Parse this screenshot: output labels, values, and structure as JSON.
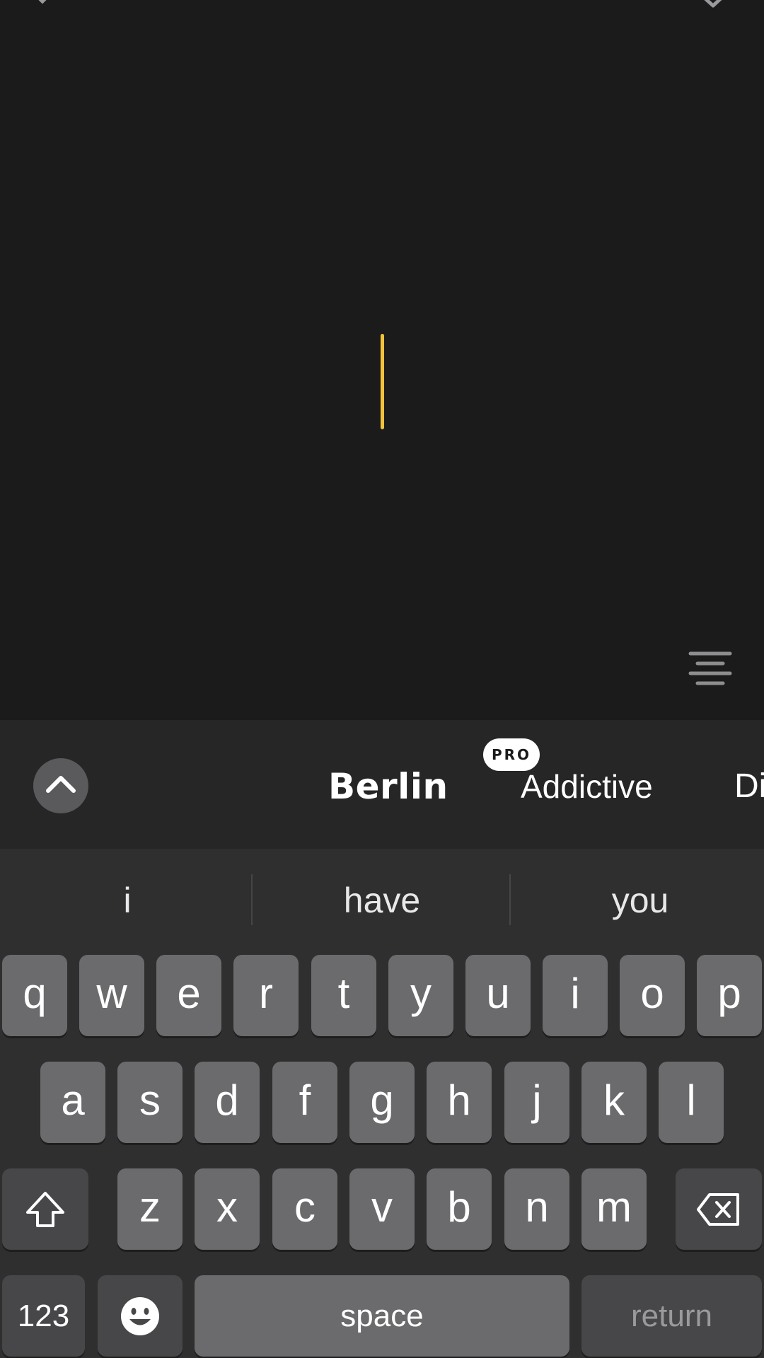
{
  "editor": {
    "close_icon": "close-icon",
    "done_icon": "checkmark-icon",
    "align_icon": "align-center-icon",
    "cursor_color": "#f3c23c"
  },
  "font_bar": {
    "toggle_icon": "chevron-up-icon",
    "fonts": [
      {
        "name": "Berlin",
        "selected": true
      },
      {
        "name": "Addictive",
        "badge": "PRO"
      },
      {
        "name": "Di"
      }
    ]
  },
  "keyboard": {
    "suggestions": [
      "i",
      "have",
      "you"
    ],
    "row1": [
      "q",
      "w",
      "e",
      "r",
      "t",
      "y",
      "u",
      "i",
      "o",
      "p"
    ],
    "row2": [
      "a",
      "s",
      "d",
      "f",
      "g",
      "h",
      "j",
      "k",
      "l"
    ],
    "row3": [
      "z",
      "x",
      "c",
      "v",
      "b",
      "n",
      "m"
    ],
    "shift_icon": "shift-icon",
    "delete_icon": "backspace-icon",
    "numbers_label": "123",
    "emoji_icon": "emoji-icon",
    "space_label": "space",
    "return_label": "return"
  }
}
